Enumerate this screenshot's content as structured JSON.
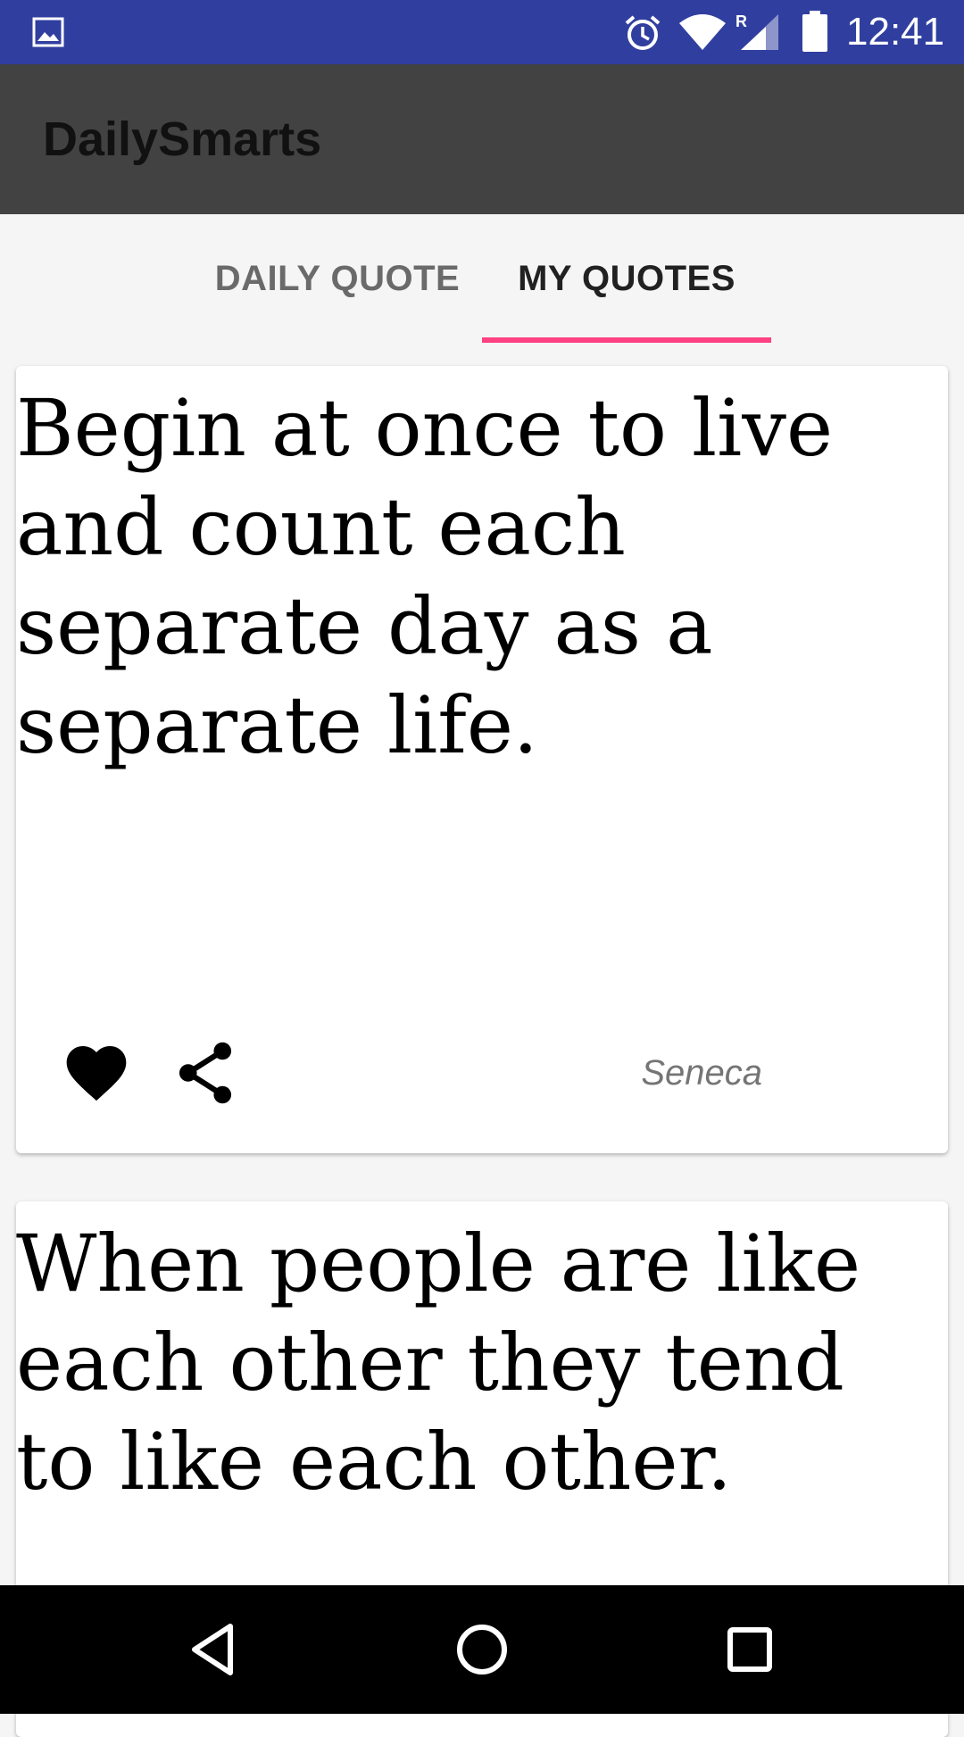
{
  "status_bar": {
    "time": "12:41",
    "icons": [
      "gallery-icon",
      "alarm-icon",
      "wifi-icon",
      "signal-roaming-icon",
      "battery-icon"
    ],
    "roaming_indicator": "R",
    "background_color": "#303f9f"
  },
  "app_bar": {
    "title": "DailySmarts",
    "background_color": "#424242"
  },
  "tabs": [
    {
      "label": "DAILY QUOTE",
      "selected": false
    },
    {
      "label": "MY QUOTES",
      "selected": true
    }
  ],
  "accent_color": "#ff4081",
  "quotes": [
    {
      "text": "Begin at once to live and count each separate day as a separate life.",
      "author": "Seneca",
      "liked": true,
      "actions": [
        "heart-icon",
        "share-icon"
      ]
    },
    {
      "text": "When people are like each other they tend to like each other."
    }
  ],
  "nav_bar": {
    "buttons": [
      "back-icon",
      "home-icon",
      "recents-icon"
    ]
  }
}
